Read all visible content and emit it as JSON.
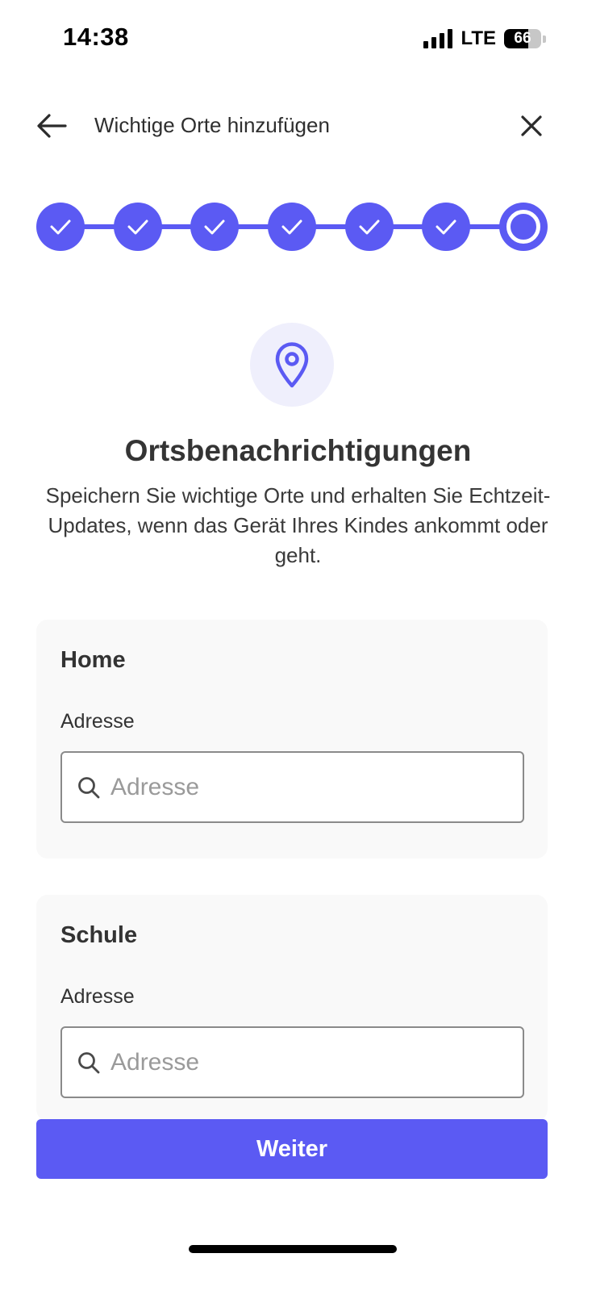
{
  "status_bar": {
    "time": "14:38",
    "network": "LTE",
    "battery_level": "66",
    "battery_fraction": 0.66
  },
  "header": {
    "title": "Wichtige Orte hinzufügen",
    "back_icon": "arrow-left-icon",
    "close_icon": "close-icon"
  },
  "stepper": {
    "total_steps": 7,
    "completed_steps": 6,
    "current_step": 7,
    "accent_color": "#5b5af3"
  },
  "intro": {
    "icon": "location-pin-icon",
    "title": "Ortsbenachrichtigungen",
    "description": "Speichern Sie wichtige Orte und erhalten Sie Echtzeit-Updates, wenn das Gerät Ihres Kindes ankommt oder geht."
  },
  "places": [
    {
      "title": "Home",
      "field_label": "Adresse",
      "value": "",
      "placeholder": "Adresse"
    },
    {
      "title": "Schule",
      "field_label": "Adresse",
      "value": "",
      "placeholder": "Adresse"
    }
  ],
  "footer": {
    "primary_button_label": "Weiter"
  },
  "colors": {
    "accent": "#5b5af3",
    "card_background": "#f9f9f9",
    "icon_circle_background": "#efeffc"
  }
}
